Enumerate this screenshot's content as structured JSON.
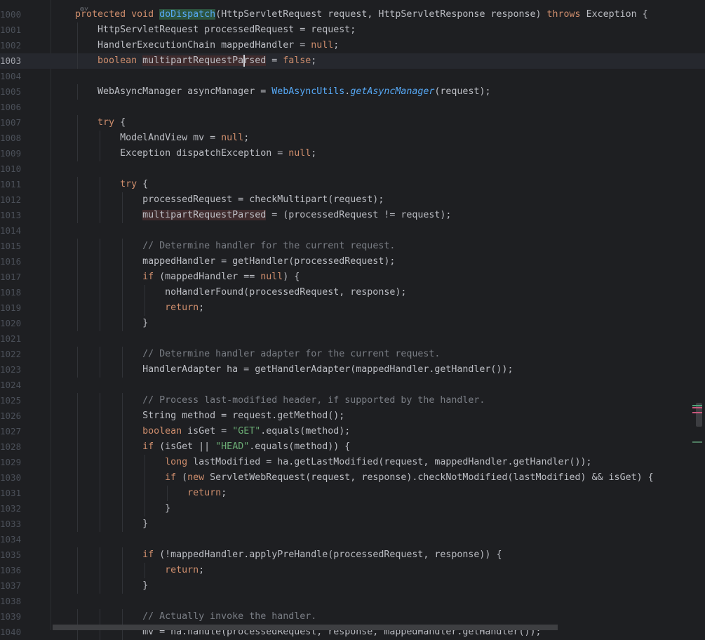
{
  "colors": {
    "background": "#1e1f22",
    "keyword": "#cf8e6d",
    "text": "#bcbec4",
    "method": "#56a8f5",
    "string": "#6aab73",
    "comment": "#7a7e85"
  },
  "editor": {
    "current_line": "1003",
    "lines": [
      {
        "n": "1000",
        "tokens": [
          [
            "t",
            "    "
          ],
          [
            "k",
            "protected void "
          ],
          [
            "hlg",
            "doDispatch"
          ],
          [
            "t",
            "(HttpServletRequest request, HttpServletResponse response) "
          ],
          [
            "k",
            "throws"
          ],
          [
            "t",
            " Exception {"
          ]
        ]
      },
      {
        "n": "1001",
        "tokens": [
          [
            "t",
            "        HttpServletRequest processedRequest = request;"
          ]
        ]
      },
      {
        "n": "1002",
        "tokens": [
          [
            "t",
            "        HandlerExecutionChain mappedHandler = "
          ],
          [
            "k",
            "null"
          ],
          [
            "t",
            ";"
          ]
        ]
      },
      {
        "n": "1003",
        "tokens": [
          [
            "t",
            "        "
          ],
          [
            "k",
            "boolean "
          ],
          [
            "hlr",
            "multipartRequestParsed"
          ],
          [
            "t",
            " = "
          ],
          [
            "k",
            "false"
          ],
          [
            "t",
            ";"
          ]
        ]
      },
      {
        "n": "1004",
        "tokens": []
      },
      {
        "n": "1005",
        "tokens": [
          [
            "t",
            "        WebAsyncManager asyncManager = "
          ],
          [
            "f",
            "WebAsyncUtils"
          ],
          [
            "t",
            "."
          ],
          [
            "s",
            "getAsyncManager"
          ],
          [
            "t",
            "(request);"
          ]
        ]
      },
      {
        "n": "1006",
        "tokens": []
      },
      {
        "n": "1007",
        "tokens": [
          [
            "t",
            "        "
          ],
          [
            "k",
            "try"
          ],
          [
            "t",
            " {"
          ]
        ]
      },
      {
        "n": "1008",
        "tokens": [
          [
            "t",
            "            ModelAndView mv = "
          ],
          [
            "k",
            "null"
          ],
          [
            "t",
            ";"
          ]
        ]
      },
      {
        "n": "1009",
        "tokens": [
          [
            "t",
            "            Exception dispatchException = "
          ],
          [
            "k",
            "null"
          ],
          [
            "t",
            ";"
          ]
        ]
      },
      {
        "n": "1010",
        "tokens": []
      },
      {
        "n": "1011",
        "tokens": [
          [
            "t",
            "            "
          ],
          [
            "k",
            "try"
          ],
          [
            "t",
            " {"
          ]
        ]
      },
      {
        "n": "1012",
        "tokens": [
          [
            "t",
            "                processedRequest = checkMultipart(request);"
          ]
        ]
      },
      {
        "n": "1013",
        "tokens": [
          [
            "t",
            "                "
          ],
          [
            "hlr",
            "multipartRequestParsed"
          ],
          [
            "t",
            " = (processedRequest != request);"
          ]
        ]
      },
      {
        "n": "1014",
        "tokens": []
      },
      {
        "n": "1015",
        "tokens": [
          [
            "t",
            "                "
          ],
          [
            "c",
            "// Determine handler for the current request."
          ]
        ]
      },
      {
        "n": "1016",
        "tokens": [
          [
            "t",
            "                mappedHandler = getHandler(processedRequest);"
          ]
        ]
      },
      {
        "n": "1017",
        "tokens": [
          [
            "t",
            "                "
          ],
          [
            "k",
            "if"
          ],
          [
            "t",
            " (mappedHandler == "
          ],
          [
            "k",
            "null"
          ],
          [
            "t",
            ") {"
          ]
        ]
      },
      {
        "n": "1018",
        "tokens": [
          [
            "t",
            "                    noHandlerFound(processedRequest, response);"
          ]
        ]
      },
      {
        "n": "1019",
        "tokens": [
          [
            "t",
            "                    "
          ],
          [
            "k",
            "return"
          ],
          [
            "t",
            ";"
          ]
        ]
      },
      {
        "n": "1020",
        "tokens": [
          [
            "t",
            "                }"
          ]
        ]
      },
      {
        "n": "1021",
        "tokens": []
      },
      {
        "n": "1022",
        "tokens": [
          [
            "t",
            "                "
          ],
          [
            "c",
            "// Determine handler adapter for the current request."
          ]
        ]
      },
      {
        "n": "1023",
        "tokens": [
          [
            "t",
            "                HandlerAdapter ha = getHandlerAdapter(mappedHandler.getHandler());"
          ]
        ]
      },
      {
        "n": "1024",
        "tokens": []
      },
      {
        "n": "1025",
        "tokens": [
          [
            "t",
            "                "
          ],
          [
            "c",
            "// Process last-modified header, if supported by the handler."
          ]
        ]
      },
      {
        "n": "1026",
        "tokens": [
          [
            "t",
            "                String method = request.getMethod();"
          ]
        ]
      },
      {
        "n": "1027",
        "tokens": [
          [
            "t",
            "                "
          ],
          [
            "k",
            "boolean "
          ],
          [
            "t",
            "isGet = "
          ],
          [
            "str",
            "\"GET\""
          ],
          [
            "t",
            ".equals(method);"
          ]
        ]
      },
      {
        "n": "1028",
        "tokens": [
          [
            "t",
            "                "
          ],
          [
            "k",
            "if"
          ],
          [
            "t",
            " (isGet || "
          ],
          [
            "str",
            "\"HEAD\""
          ],
          [
            "t",
            ".equals(method)) {"
          ]
        ]
      },
      {
        "n": "1029",
        "tokens": [
          [
            "t",
            "                    "
          ],
          [
            "k",
            "long "
          ],
          [
            "t",
            "lastModified = ha.getLastModified(request, mappedHandler.getHandler());"
          ]
        ]
      },
      {
        "n": "1030",
        "tokens": [
          [
            "t",
            "                    "
          ],
          [
            "k",
            "if"
          ],
          [
            "t",
            " ("
          ],
          [
            "k",
            "new "
          ],
          [
            "t",
            "ServletWebRequest(request, response).checkNotModified(lastModified) && isGet) {"
          ]
        ]
      },
      {
        "n": "1031",
        "tokens": [
          [
            "t",
            "                        "
          ],
          [
            "k",
            "return"
          ],
          [
            "t",
            ";"
          ]
        ]
      },
      {
        "n": "1032",
        "tokens": [
          [
            "t",
            "                    }"
          ]
        ]
      },
      {
        "n": "1033",
        "tokens": [
          [
            "t",
            "                }"
          ]
        ]
      },
      {
        "n": "1034",
        "tokens": []
      },
      {
        "n": "1035",
        "tokens": [
          [
            "t",
            "                "
          ],
          [
            "k",
            "if"
          ],
          [
            "t",
            " (!mappedHandler.applyPreHandle(processedRequest, response)) {"
          ]
        ]
      },
      {
        "n": "1036",
        "tokens": [
          [
            "t",
            "                    "
          ],
          [
            "k",
            "return"
          ],
          [
            "t",
            ";"
          ]
        ]
      },
      {
        "n": "1037",
        "tokens": [
          [
            "t",
            "                }"
          ]
        ]
      },
      {
        "n": "1038",
        "tokens": []
      },
      {
        "n": "1039",
        "tokens": [
          [
            "t",
            "                "
          ],
          [
            "c",
            "// Actually invoke the handler."
          ]
        ]
      },
      {
        "n": "1040",
        "tokens": [
          [
            "t",
            "                mv = ha.handle(processedRequest, response, mappedHandler.getHandler());"
          ]
        ]
      }
    ]
  }
}
